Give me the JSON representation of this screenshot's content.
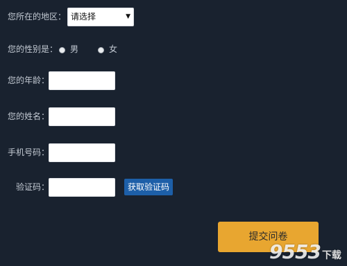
{
  "form": {
    "region_label": "您所在的地区：",
    "region_selected": "请选择",
    "gender_label": "您的性别是：",
    "gender_options": [
      "男",
      "女"
    ],
    "age_label": "您的年龄：",
    "name_label": "您的姓名：",
    "phone_label": "手机号码：",
    "code_label": "验证码：",
    "get_code_button": "获取验证码",
    "submit_button": "提交问卷"
  },
  "icons": {
    "dropdown": "chevron-down-icon"
  },
  "colors": {
    "background": "#19222f",
    "get_code_button": "#1d5fa8",
    "submit_button": "#e8a630"
  },
  "watermark": {
    "number": "9553",
    "text": "下载"
  }
}
